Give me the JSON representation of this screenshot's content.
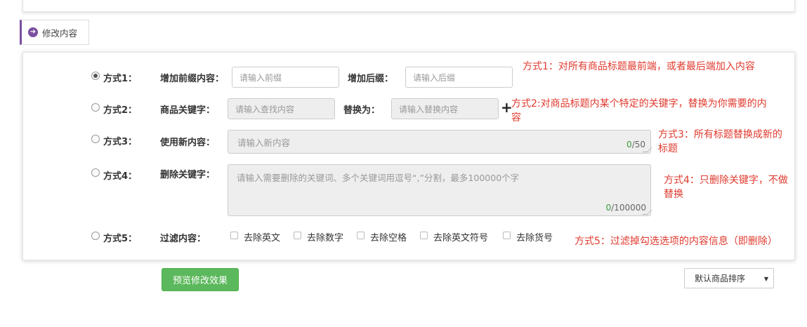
{
  "section_tab": {
    "label": "修改内容",
    "accent": "#7b4fa0"
  },
  "methods": [
    {
      "label": "方式1：",
      "checked": true
    },
    {
      "label": "方式2：",
      "checked": false
    },
    {
      "label": "方式3：",
      "checked": false
    },
    {
      "label": "方式4：",
      "checked": false
    },
    {
      "label": "方式5：",
      "checked": false
    }
  ],
  "method1": {
    "prefix_label": "增加前缀内容：",
    "prefix_placeholder": "请输入前缀",
    "suffix_label": "增加后缀：",
    "suffix_placeholder": "请输入后缀"
  },
  "method2": {
    "keyword_label": "商品关键字：",
    "keyword_placeholder": "请输入查找内容",
    "replace_label": "替换为：",
    "replace_placeholder": "请输入替换内容",
    "add_icon": "plus-icon"
  },
  "method3": {
    "label": "使用新内容：",
    "placeholder": "请输入新内容",
    "count_current": "0",
    "count_max": "/50"
  },
  "method4": {
    "label": "删除关键字：",
    "placeholder": "请输入需要删除的关键词、多个关键词用逗号“,”分割，最多100000个字",
    "count_current": "0",
    "count_max": "/100000"
  },
  "method5": {
    "label": "过滤内容：",
    "options": [
      "去除英文",
      "去除数字",
      "去除空格",
      "去除英文符号",
      "去除货号"
    ]
  },
  "notes": {
    "note1": "方式1：对所有商品标题最前端，或者最后端加入内容",
    "note2_line1": "方式2:对商品标题内某个特定的关键字，替换为你需要的内",
    "note2_line2": "容",
    "note3_line1": "方式3：所有标题替换成新的",
    "note3_line2": "标题",
    "note4_line1": "方式4：只删除关键字，不做",
    "note4_line2": "替换",
    "note5": "方式5：过滤掉勾选选项的内容信息（即删除）"
  },
  "preview_button": "预览修改效果",
  "sort_select": {
    "selected": "默认商品排序"
  },
  "colors": {
    "note_red": "#e03a2e",
    "button_green": "#5cb85c",
    "counter_green": "#3c9a3c"
  }
}
